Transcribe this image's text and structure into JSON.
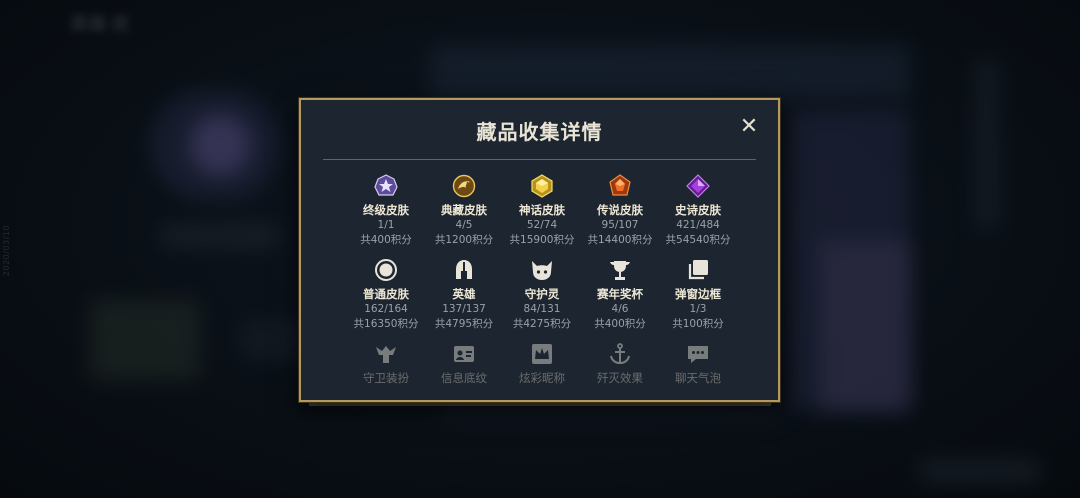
{
  "background": {
    "title": "英雄·皮",
    "side_text": "2020/03/10"
  },
  "modal": {
    "title": "藏品收集详情",
    "close_symbol": "✕",
    "rows": [
      [
        {
          "name": "ultimate-skin",
          "icon": "ultimate-gem-icon",
          "label": "终级皮肤",
          "count": "1/1",
          "points": "共400积分",
          "color": "#a48be0"
        },
        {
          "name": "collector-skin",
          "icon": "dragon-emblem-icon",
          "label": "典藏皮肤",
          "count": "4/5",
          "points": "共1200积分",
          "color": "#d9a640"
        },
        {
          "name": "mythic-skin",
          "icon": "mythic-gem-icon",
          "label": "神话皮肤",
          "count": "52/74",
          "points": "共15900积分",
          "color": "#e7c23a"
        },
        {
          "name": "legendary-skin",
          "icon": "legendary-gem-icon",
          "label": "传说皮肤",
          "count": "95/107",
          "points": "共14400积分",
          "color": "#e06a2a"
        },
        {
          "name": "epic-skin",
          "icon": "epic-gem-icon",
          "label": "史诗皮肤",
          "count": "421/484",
          "points": "共54540积分",
          "color": "#a54cd8"
        }
      ],
      [
        {
          "name": "normal-skin",
          "icon": "circle-icon",
          "label": "普通皮肤",
          "count": "162/164",
          "points": "共16350积分",
          "color": "#e8e4da"
        },
        {
          "name": "hero",
          "icon": "helmet-icon",
          "label": "英雄",
          "count": "137/137",
          "points": "共4795积分",
          "color": "#e8e4da"
        },
        {
          "name": "guardian-spirit",
          "icon": "spirit-icon",
          "label": "守护灵",
          "count": "84/131",
          "points": "共4275积分",
          "color": "#e8e4da"
        },
        {
          "name": "season-trophy",
          "icon": "trophy-icon",
          "label": "赛年奖杯",
          "count": "4/6",
          "points": "共400积分",
          "color": "#e8e4da"
        },
        {
          "name": "popup-frame",
          "icon": "frame-icon",
          "label": "弹窗边框",
          "count": "1/3",
          "points": "共100积分",
          "color": "#e8e4da"
        }
      ],
      [
        {
          "name": "guard-outfit",
          "icon": "guard-icon",
          "label": "守卫装扮"
        },
        {
          "name": "info-pattern",
          "icon": "id-card-icon",
          "label": "信息底纹"
        },
        {
          "name": "colorful-nickname",
          "icon": "crown-card-icon",
          "label": "炫彩昵称"
        },
        {
          "name": "kill-effect",
          "icon": "anchor-icon",
          "label": "歼灭效果"
        },
        {
          "name": "chat-bubble",
          "icon": "chat-bubble-icon",
          "label": "聊天气泡"
        }
      ]
    ]
  }
}
